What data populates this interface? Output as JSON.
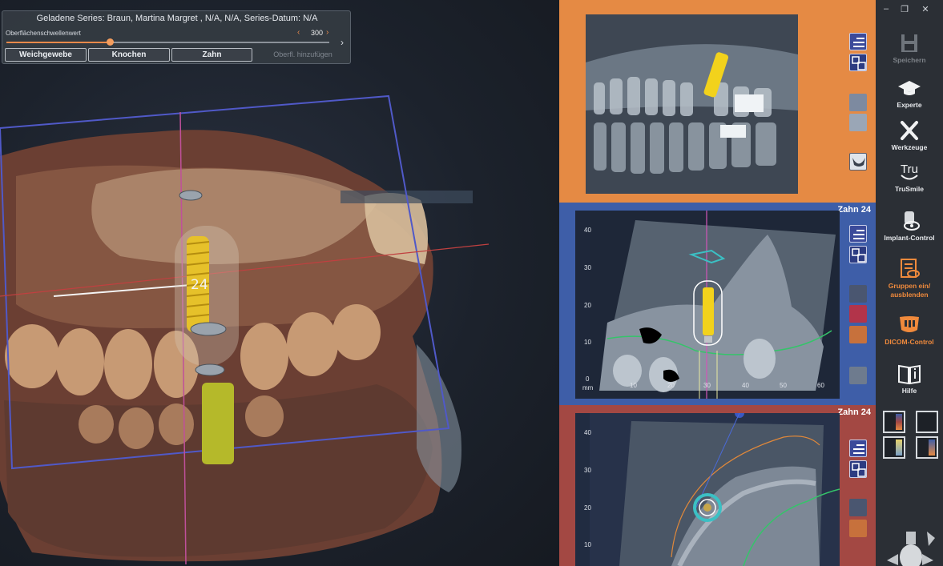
{
  "series_panel": {
    "title": "Geladene Series: Braun, Martina Margret , N/A, N/A, Series-Datum: N/A",
    "threshold_label": "Oberflächenschwellenwert",
    "threshold_value": "300",
    "threshold_fraction": 0.32,
    "buttons": [
      "Weichgewebe",
      "Knochen",
      "Zahn"
    ],
    "add_surface": "Oberfl. hinzufügen"
  },
  "viewport": {
    "implant_label": "24"
  },
  "views": {
    "cross": {
      "title": "Zahn 24",
      "y_ticks": [
        "40",
        "30",
        "20",
        "10",
        "0"
      ],
      "x_unit": "mm",
      "x_ticks": [
        "10",
        "20",
        "30",
        "40",
        "50",
        "60"
      ]
    },
    "axial": {
      "title": "Zahn 24",
      "y_ticks": [
        "40",
        "30",
        "20",
        "10"
      ]
    }
  },
  "toolbar": {
    "window": {
      "minimize": "–",
      "restore": "❐",
      "close": "✕"
    },
    "tools": [
      {
        "label": "Speichern",
        "icon": "save-icon",
        "state": "disabled"
      },
      {
        "label": "Experte",
        "icon": "graduation-cap-icon",
        "state": "normal"
      },
      {
        "label": "Werkzeuge",
        "icon": "tools-icon",
        "state": "normal"
      },
      {
        "label": "TruSmile",
        "icon": "trusmile-icon",
        "icon_text": "Tru",
        "state": "normal"
      },
      {
        "label": "Implant-Control",
        "icon": "implant-control-icon",
        "state": "normal"
      },
      {
        "label": "Gruppen ein/ ausblenden",
        "icon": "groups-toggle-icon",
        "state": "active"
      },
      {
        "label": "DICOM-Control",
        "icon": "dicom-control-icon",
        "state": "active"
      },
      {
        "label": "Hilfe",
        "icon": "help-book-icon",
        "state": "normal"
      }
    ]
  },
  "colors": {
    "pano_bg": "#e58a44",
    "cross_bg": "#3e5ea8",
    "axial_bg": "#a34843",
    "accent": "#f08a3c",
    "implant": "#f2d21c"
  }
}
